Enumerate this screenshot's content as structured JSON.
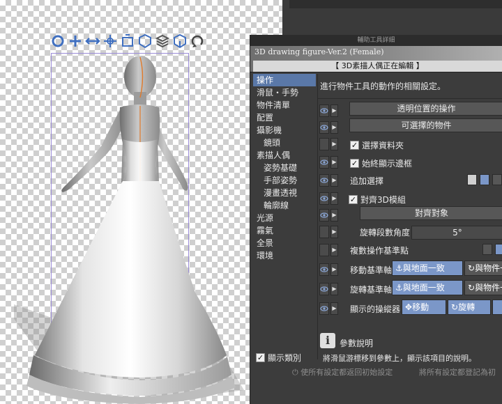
{
  "gizmo_icons": [
    "move-gizmo-icon",
    "pan-icon",
    "move-along-axis-icon",
    "rotate-object-icon",
    "move-object-icon",
    "rotate-object-3d-icon",
    "move-object-3d-icon",
    "rotate-ground-icon",
    "rotate-camera-icon"
  ],
  "dialog": {
    "window_title": "輔助工具詳細",
    "subtitle": "3D drawing figure-Ver.2 (Female)",
    "status": "【 3D素描人偶正在編輯 】",
    "categories": [
      {
        "label": "操作",
        "selected": true,
        "indent": 0
      },
      {
        "label": "滑鼠・手勢",
        "indent": 0
      },
      {
        "label": "物件清單",
        "indent": 0
      },
      {
        "label": "配置",
        "indent": 0
      },
      {
        "label": "攝影機",
        "indent": 0
      },
      {
        "label": "鏡頭",
        "indent": 1
      },
      {
        "label": "素描人偶",
        "indent": 0
      },
      {
        "label": "姿勢基礎",
        "indent": 2
      },
      {
        "label": "手部姿勢",
        "indent": 2
      },
      {
        "label": "漫畫透視",
        "indent": 2
      },
      {
        "label": "輪廓線",
        "indent": 2
      },
      {
        "label": "光源",
        "indent": 0
      },
      {
        "label": "霧氣",
        "indent": 0
      },
      {
        "label": "全景",
        "indent": 0
      },
      {
        "label": "環境",
        "indent": 0
      }
    ],
    "show_category_label": "顯示類別",
    "description": "進行物件工具的動作的相關設定。",
    "transparent_btn": "透明位置的操作",
    "selectable_btn": "可選擇的物件",
    "select_folder": "選擇資料夾",
    "always_border": "始終顯示邊框",
    "add_select": "追加選擇",
    "align_3d": "對齊3D模組",
    "align_target": "對齊對象",
    "rotate_step_label": "旋轉段數角度",
    "rotate_step_value": "5°",
    "multi_base": "複數操作基準點",
    "move_axis_label": "移動基準軸",
    "rotate_axis_label": "旋轉基準軸",
    "ground_align": "與地面一致",
    "object_align": "與物件一",
    "manipulator_label": "顯示的操縱器",
    "move_label": "移動",
    "rotate_label": "旋轉",
    "param_title": "參數說明",
    "param_text": "將滑鼠游標移到參數上，顯示該項目的說明。",
    "footer_reset": "使所有設定都返回初始設定",
    "footer_register": "將所有設定都登記為初"
  },
  "colors": {
    "accent": "#7b97c8",
    "selection": "#5a78a8",
    "gizmo": "#3f6fc0",
    "bbox": "#9b8cd8",
    "center_line": "#e07a2a"
  }
}
